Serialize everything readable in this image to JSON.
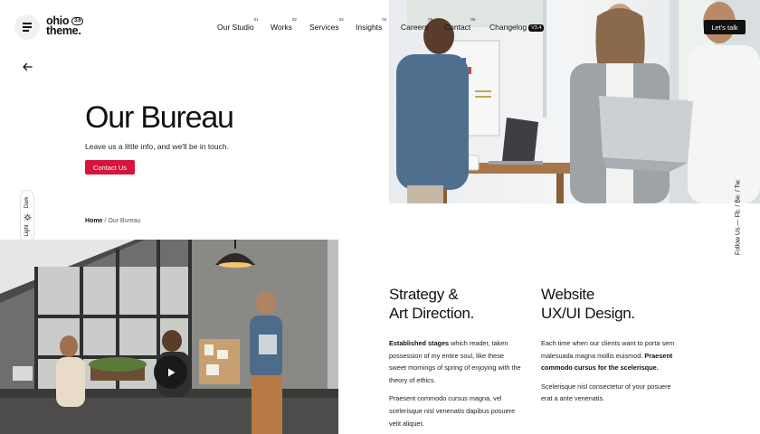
{
  "header": {
    "logo_line1": "ohio",
    "logo_line2": "theme.",
    "logo_version": "3.6",
    "nav": [
      {
        "label": "Our Studio",
        "num": "01"
      },
      {
        "label": "Works",
        "num": "02"
      },
      {
        "label": "Services",
        "num": "03"
      },
      {
        "label": "Insights",
        "num": "04"
      },
      {
        "label": "Careers",
        "num": "05"
      },
      {
        "label": "Contact",
        "num": "06"
      }
    ],
    "changelog_label": "Changelog",
    "changelog_version": "V3.4",
    "cta_label": "Let's talk"
  },
  "hero": {
    "title": "Our Bureau",
    "subtitle": "Leave us a little info, and we'll be in touch.",
    "button_label": "Contact Us"
  },
  "breadcrumb": {
    "home": "Home",
    "separator": "/",
    "current": "Our Bureau"
  },
  "theme_switch": {
    "light": "Light",
    "dark": "Dark"
  },
  "social": {
    "text": "Follow Us  —  Fb. / Be. / Tw."
  },
  "services": [
    {
      "title_line1": "Strategy &",
      "title_line2": "Art Direction.",
      "p1_bold": "Established stages",
      "p1_rest": " which reader, taken possession of my entire soul, like these sweet mornings of spring of enjoying with the theory of ethics.",
      "p2": "Praesent commodo cursus magna, vel scelerisque nisl venenatis dapibus posuere velit aliquet."
    },
    {
      "title_line1": "Website",
      "title_line2": "UX/UI Design.",
      "p1_start": "Each time when our clients want to porta sem malesuada magna mollis euismod. ",
      "p1_bold": "Praesent commodo cursus for the scelerisque.",
      "p2": "Scelerisque nisl consectetur of your posuere erat a ante venenatis."
    }
  ],
  "colors": {
    "accent": "#d6143c",
    "dark": "#111111"
  },
  "icons": {
    "menu": "hamburger-icon",
    "back": "arrow-left-icon",
    "play": "play-icon",
    "sun": "sun-icon"
  }
}
